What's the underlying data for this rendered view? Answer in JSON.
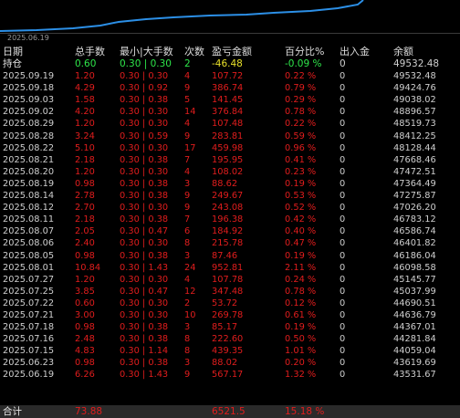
{
  "chart": {
    "date_label": "2025.06.19"
  },
  "headers": [
    "日期",
    "总手数",
    "最小|大手数",
    "次数",
    "盈亏金额",
    "百分比%",
    "出入金",
    "余额"
  ],
  "holding": {
    "date": "持仓",
    "lots": "0.60",
    "minmax": "0.30 | 0.30",
    "count": "2",
    "pnl": "-46.48",
    "pct": "-0.09 %",
    "flow": "0",
    "balance": "49532.48"
  },
  "rows": [
    {
      "date": "2025.09.19",
      "lots": "1.20",
      "minmax": "0.30 | 0.30",
      "count": "4",
      "pnl": "107.72",
      "pct": "0.22 %",
      "flow": "0",
      "balance": "49532.48"
    },
    {
      "date": "2025.09.18",
      "lots": "4.29",
      "minmax": "0.30 | 0.92",
      "count": "9",
      "pnl": "386.74",
      "pct": "0.79 %",
      "flow": "0",
      "balance": "49424.76"
    },
    {
      "date": "2025.09.03",
      "lots": "1.58",
      "minmax": "0.30 | 0.38",
      "count": "5",
      "pnl": "141.45",
      "pct": "0.29 %",
      "flow": "0",
      "balance": "49038.02"
    },
    {
      "date": "2025.09.02",
      "lots": "4.20",
      "minmax": "0.30 | 0.30",
      "count": "14",
      "pnl": "376.84",
      "pct": "0.78 %",
      "flow": "0",
      "balance": "48896.57"
    },
    {
      "date": "2025.08.29",
      "lots": "1.20",
      "minmax": "0.30 | 0.30",
      "count": "4",
      "pnl": "107.48",
      "pct": "0.22 %",
      "flow": "0",
      "balance": "48519.73"
    },
    {
      "date": "2025.08.28",
      "lots": "3.24",
      "minmax": "0.30 | 0.59",
      "count": "9",
      "pnl": "283.81",
      "pct": "0.59 %",
      "flow": "0",
      "balance": "48412.25"
    },
    {
      "date": "2025.08.22",
      "lots": "5.10",
      "minmax": "0.30 | 0.30",
      "count": "17",
      "pnl": "459.98",
      "pct": "0.96 %",
      "flow": "0",
      "balance": "48128.44"
    },
    {
      "date": "2025.08.21",
      "lots": "2.18",
      "minmax": "0.30 | 0.38",
      "count": "7",
      "pnl": "195.95",
      "pct": "0.41 %",
      "flow": "0",
      "balance": "47668.46"
    },
    {
      "date": "2025.08.20",
      "lots": "1.20",
      "minmax": "0.30 | 0.30",
      "count": "4",
      "pnl": "108.02",
      "pct": "0.23 %",
      "flow": "0",
      "balance": "47472.51"
    },
    {
      "date": "2025.08.19",
      "lots": "0.98",
      "minmax": "0.30 | 0.38",
      "count": "3",
      "pnl": "88.62",
      "pct": "0.19 %",
      "flow": "0",
      "balance": "47364.49"
    },
    {
      "date": "2025.08.14",
      "lots": "2.78",
      "minmax": "0.30 | 0.38",
      "count": "9",
      "pnl": "249.67",
      "pct": "0.53 %",
      "flow": "0",
      "balance": "47275.87"
    },
    {
      "date": "2025.08.12",
      "lots": "2.70",
      "minmax": "0.30 | 0.30",
      "count": "9",
      "pnl": "243.08",
      "pct": "0.52 %",
      "flow": "0",
      "balance": "47026.20"
    },
    {
      "date": "2025.08.11",
      "lots": "2.18",
      "minmax": "0.30 | 0.38",
      "count": "7",
      "pnl": "196.38",
      "pct": "0.42 %",
      "flow": "0",
      "balance": "46783.12"
    },
    {
      "date": "2025.08.07",
      "lots": "2.05",
      "minmax": "0.30 | 0.47",
      "count": "6",
      "pnl": "184.92",
      "pct": "0.40 %",
      "flow": "0",
      "balance": "46586.74"
    },
    {
      "date": "2025.08.06",
      "lots": "2.40",
      "minmax": "0.30 | 0.30",
      "count": "8",
      "pnl": "215.78",
      "pct": "0.47 %",
      "flow": "0",
      "balance": "46401.82"
    },
    {
      "date": "2025.08.05",
      "lots": "0.98",
      "minmax": "0.30 | 0.38",
      "count": "3",
      "pnl": "87.46",
      "pct": "0.19 %",
      "flow": "0",
      "balance": "46186.04"
    },
    {
      "date": "2025.08.01",
      "lots": "10.84",
      "minmax": "0.30 | 1.43",
      "count": "24",
      "pnl": "952.81",
      "pct": "2.11 %",
      "flow": "0",
      "balance": "46098.58"
    },
    {
      "date": "2025.07.27",
      "lots": "1.20",
      "minmax": "0.30 | 0.30",
      "count": "4",
      "pnl": "107.78",
      "pct": "0.24 %",
      "flow": "0",
      "balance": "45145.77"
    },
    {
      "date": "2025.07.25",
      "lots": "3.85",
      "minmax": "0.30 | 0.47",
      "count": "12",
      "pnl": "347.48",
      "pct": "0.78 %",
      "flow": "0",
      "balance": "45037.99"
    },
    {
      "date": "2025.07.22",
      "lots": "0.60",
      "minmax": "0.30 | 0.30",
      "count": "2",
      "pnl": "53.72",
      "pct": "0.12 %",
      "flow": "0",
      "balance": "44690.51"
    },
    {
      "date": "2025.07.21",
      "lots": "3.00",
      "minmax": "0.30 | 0.30",
      "count": "10",
      "pnl": "269.78",
      "pct": "0.61 %",
      "flow": "0",
      "balance": "44636.79"
    },
    {
      "date": "2025.07.18",
      "lots": "0.98",
      "minmax": "0.30 | 0.38",
      "count": "3",
      "pnl": "85.17",
      "pct": "0.19 %",
      "flow": "0",
      "balance": "44367.01"
    },
    {
      "date": "2025.07.16",
      "lots": "2.48",
      "minmax": "0.30 | 0.38",
      "count": "8",
      "pnl": "222.60",
      "pct": "0.50 %",
      "flow": "0",
      "balance": "44281.84"
    },
    {
      "date": "2025.07.15",
      "lots": "4.83",
      "minmax": "0.30 | 1.14",
      "count": "8",
      "pnl": "439.35",
      "pct": "1.01 %",
      "flow": "0",
      "balance": "44059.04"
    },
    {
      "date": "2025.06.23",
      "lots": "0.98",
      "minmax": "0.30 | 0.38",
      "count": "3",
      "pnl": "88.02",
      "pct": "0.20 %",
      "flow": "0",
      "balance": "43619.69"
    },
    {
      "date": "2025.06.19",
      "lots": "6.26",
      "minmax": "0.30 | 1.43",
      "count": "9",
      "pnl": "567.17",
      "pct": "1.32 %",
      "flow": "0",
      "balance": "43531.67"
    }
  ],
  "total": {
    "label": "合计",
    "lots": "73.88",
    "pnl": "6521.5",
    "pct": "15.18 %"
  },
  "colors": {
    "profit": "#e11d1d",
    "holding": "#2ee64a",
    "pnl_holding": "#e8e02a"
  }
}
